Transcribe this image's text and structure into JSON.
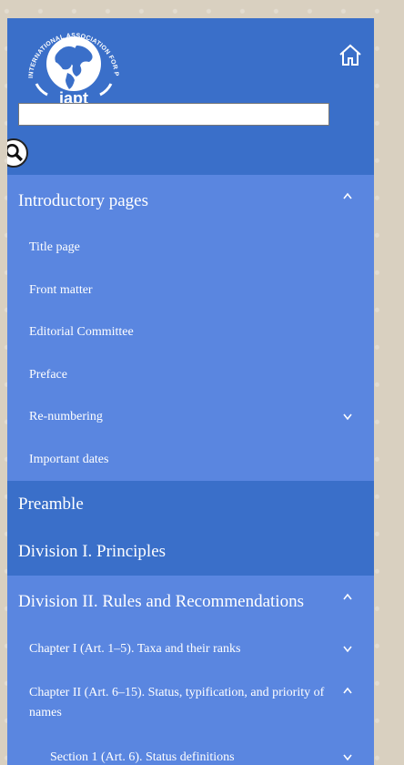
{
  "logo": {
    "org_top": "INTERNATIONAL ASSOCIATION FOR PLANT TAXONOMY",
    "org_short": "iapt"
  },
  "header": {
    "search_placeholder": "",
    "home_icon": "home-icon",
    "search_icon": "magnifier-icon"
  },
  "colors": {
    "sidebar_dark": "#3a6fc9",
    "sidebar_light": "#5a86e0",
    "text": "#ffffff"
  },
  "nav": {
    "introductory": {
      "label": "Introductory pages",
      "expanded": true,
      "items": [
        {
          "label": "Title page"
        },
        {
          "label": "Front matter"
        },
        {
          "label": "Editorial Committee"
        },
        {
          "label": "Preface"
        },
        {
          "label": "Re-numbering",
          "has_children": true
        },
        {
          "label": "Important dates"
        }
      ]
    },
    "preamble": {
      "label": "Preamble"
    },
    "division1": {
      "label": "Division I. Principles"
    },
    "division2": {
      "label": "Division II. Rules and Recommendations",
      "expanded": true,
      "items": [
        {
          "label": "Chapter I (Art. 1–5). Taxa and their ranks",
          "has_children": true
        },
        {
          "label": "Chapter II (Art. 6–15). Status, typification, and priority of names",
          "expanded": true,
          "items": [
            {
              "label": "Section 1 (Art. 6). Status definitions",
              "has_children": true
            }
          ]
        }
      ]
    }
  }
}
